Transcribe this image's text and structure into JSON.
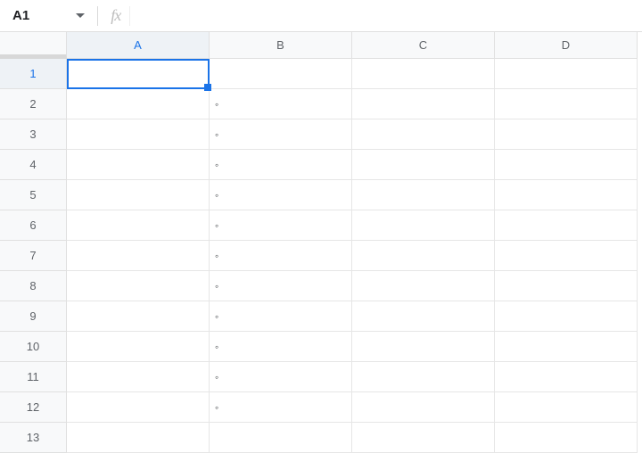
{
  "formula_bar": {
    "name_box": "A1",
    "fx_label": "fx",
    "value": ""
  },
  "columns": [
    "A",
    "B",
    "C",
    "D"
  ],
  "rows": [
    "1",
    "2",
    "3",
    "4",
    "5",
    "6",
    "7",
    "8",
    "9",
    "10",
    "11",
    "12",
    "13"
  ],
  "selected": {
    "col": "A",
    "row": "1"
  },
  "cells": {
    "B2": "◦",
    "B3": "◦",
    "B4": "◦",
    "B5": "◦",
    "B6": "◦",
    "B7": "◦",
    "B8": "◦",
    "B9": "◦",
    "B10": "◦",
    "B11": "◦",
    "B12": "◦"
  }
}
